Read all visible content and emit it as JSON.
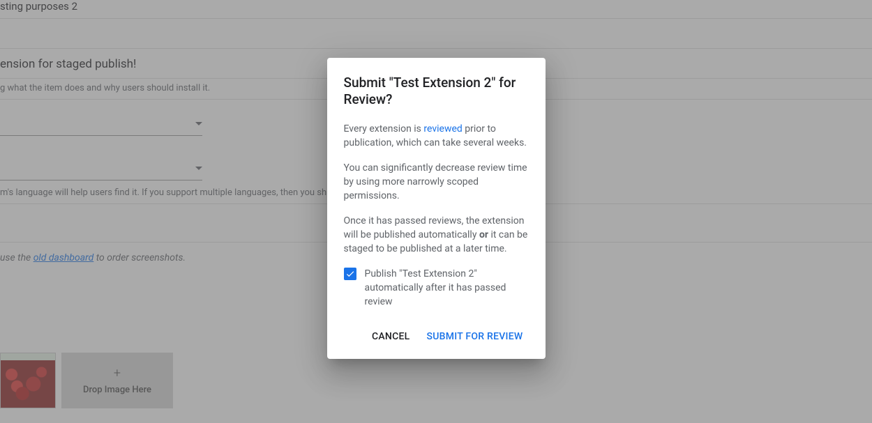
{
  "background": {
    "name_field": "sting purposes 2",
    "summary_field": "ension for staged publish!",
    "summary_hint": "g what the item does and why users should install it.",
    "language_hint": "m's language will help users find it. If you support multiple languages, then you sh",
    "screenshot_hint_pre": "use the ",
    "screenshot_hint_link": "old dashboard",
    "screenshot_hint_post": " to order screenshots.",
    "drop_label": "Drop Image Here"
  },
  "dialog": {
    "title": "Submit \"Test Extension 2\" for Review?",
    "p1_pre": "Every extension is ",
    "p1_link": "reviewed",
    "p1_post": " prior to publication, which can take several weeks.",
    "p2": "You can significantly decrease review time by using more narrowly scoped permissions.",
    "p3_pre": "Once it has passed reviews, the extension will be published automatically ",
    "p3_strong": "or",
    "p3_post": " it can be staged to be published at a later time.",
    "checkbox_label": "Publish \"Test Extension 2\" automatically after it has passed review",
    "cancel": "CANCEL",
    "submit": "SUBMIT FOR REVIEW"
  }
}
